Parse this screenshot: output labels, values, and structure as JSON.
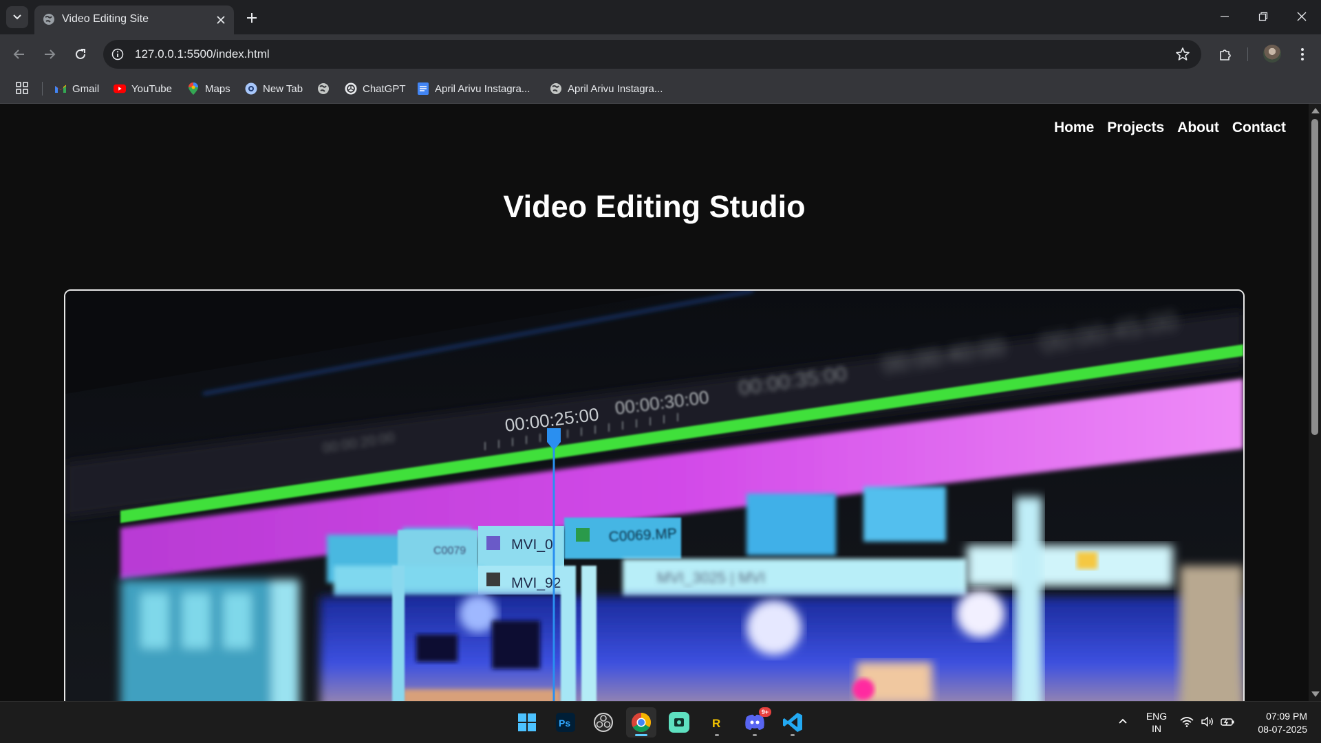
{
  "browser": {
    "tab": {
      "title": "Video Editing Site",
      "favicon": "globe-icon"
    },
    "address_bar": {
      "url": "127.0.0.1:5500/index.html"
    },
    "bookmarks": [
      {
        "label": "Gmail",
        "icon": "gmail-icon"
      },
      {
        "label": "YouTube",
        "icon": "youtube-icon"
      },
      {
        "label": "Maps",
        "icon": "maps-icon"
      },
      {
        "label": "New Tab",
        "icon": "new-tab-icon"
      },
      {
        "label": "",
        "icon": "globe-icon"
      },
      {
        "label": "ChatGPT",
        "icon": "chatgpt-icon"
      },
      {
        "label": "April Arivu Instagra...",
        "icon": "docs-icon"
      },
      {
        "label": "April Arivu Instagra...",
        "icon": "globe-icon"
      }
    ]
  },
  "page": {
    "nav": {
      "links": [
        "Home",
        "Projects",
        "About",
        "Contact"
      ]
    },
    "hero_title": "Video Editing Studio",
    "hero_image": {
      "subject": "blurred video-editing timeline photo",
      "timecodes": [
        "00:00:20:00",
        "00:00:25:00",
        "00:00:30:00",
        "00:00:35:00",
        "00:00:40:00",
        "00:00:45:00"
      ],
      "clips": [
        "C0079",
        "MVI_0",
        "C0069.MP",
        "MVI_92",
        "MVI_3025 | MVI"
      ]
    }
  },
  "taskbar": {
    "apps": [
      "windows-start-icon",
      "photoshop-icon",
      "obs-icon",
      "chrome-icon",
      "screen-recorder-icon",
      "app-r-icon",
      "discord-icon",
      "vscode-icon"
    ],
    "language": {
      "line1": "ENG",
      "line2": "IN"
    },
    "clock": {
      "time": "07:09 PM",
      "date": "08-07-2025"
    },
    "discord_badge": "9+"
  },
  "colors": {
    "page_bg": "#0e0e0e",
    "chrome_dark": "#1f2023",
    "chrome_toolbar": "#35363a",
    "timeline_magenta": "#e070f0",
    "timeline_green": "#3fe03a",
    "timeline_cyan": "#6fd8f0",
    "playhead_blue": "#2a8ff0"
  }
}
